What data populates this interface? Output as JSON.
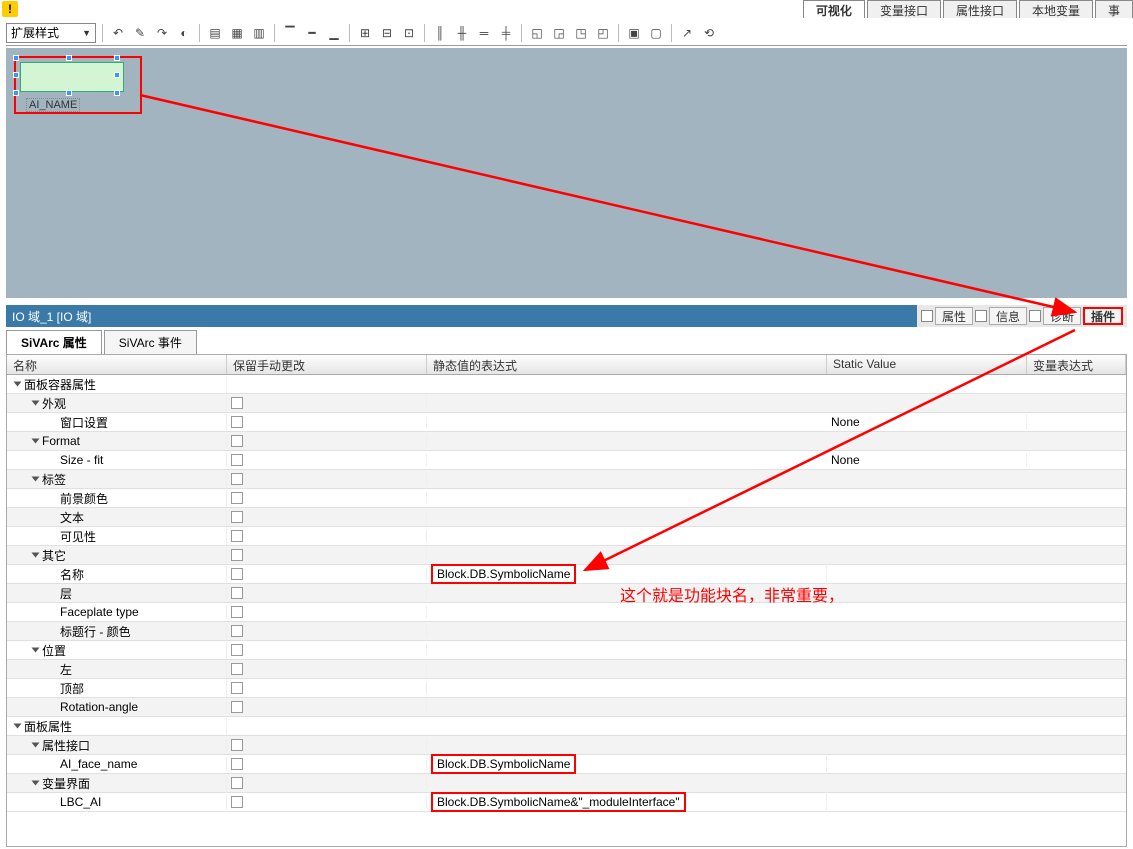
{
  "topTabs": {
    "items": [
      "可视化",
      "变量接口",
      "属性接口",
      "本地变量",
      "事"
    ],
    "activeIndex": 0
  },
  "toolbar": {
    "styleDropdown": "扩展样式"
  },
  "canvas": {
    "objectLabel": "AI_NAME"
  },
  "titleBar": {
    "title": "IO 域_1 [IO 域]",
    "buttons": {
      "properties": "属性",
      "info": "信息",
      "diagnostics": "诊断",
      "plugins": "插件"
    }
  },
  "subTabs": {
    "items": [
      "SiVArc 属性",
      "SiVArc 事件"
    ],
    "activeIndex": 0
  },
  "tableHeaders": {
    "name": "名称",
    "retain": "保留手动更改",
    "staticExpr": "静态值的表达式",
    "staticValue": "Static Value",
    "varExpr": "变量表达式"
  },
  "tableRows": [
    {
      "level": 0,
      "toggle": true,
      "open": true,
      "name": "面板容器属性",
      "chk": false,
      "expr": "",
      "static": "",
      "varExpr": ""
    },
    {
      "level": 1,
      "toggle": true,
      "open": true,
      "name": "外观",
      "chk": true,
      "expr": "",
      "static": "",
      "varExpr": ""
    },
    {
      "level": 2,
      "toggle": false,
      "name": "窗口设置",
      "chk": true,
      "expr": "",
      "static": "None",
      "varExpr": ""
    },
    {
      "level": 1,
      "toggle": true,
      "open": true,
      "name": "Format",
      "chk": true,
      "expr": "",
      "static": "",
      "varExpr": ""
    },
    {
      "level": 2,
      "toggle": false,
      "name": "Size - fit",
      "chk": true,
      "expr": "",
      "static": "None",
      "varExpr": ""
    },
    {
      "level": 1,
      "toggle": true,
      "open": true,
      "name": "标签",
      "chk": true,
      "expr": "",
      "static": "",
      "varExpr": ""
    },
    {
      "level": 2,
      "toggle": false,
      "name": "前景颜色",
      "chk": true,
      "expr": "",
      "static": "",
      "varExpr": ""
    },
    {
      "level": 2,
      "toggle": false,
      "name": "文本",
      "chk": true,
      "expr": "",
      "static": "",
      "varExpr": ""
    },
    {
      "level": 2,
      "toggle": false,
      "name": "可见性",
      "chk": true,
      "expr": "",
      "static": "",
      "varExpr": ""
    },
    {
      "level": 1,
      "toggle": true,
      "open": true,
      "name": "其它",
      "chk": true,
      "expr": "",
      "static": "",
      "varExpr": ""
    },
    {
      "level": 2,
      "toggle": false,
      "name": "名称",
      "chk": true,
      "expr": "Block.DB.SymbolicName",
      "static": "",
      "varExpr": "",
      "redbox": true
    },
    {
      "level": 2,
      "toggle": false,
      "name": "层",
      "chk": true,
      "expr": "",
      "static": "",
      "varExpr": ""
    },
    {
      "level": 2,
      "toggle": false,
      "name": "Faceplate type",
      "chk": true,
      "expr": "",
      "static": "",
      "varExpr": ""
    },
    {
      "level": 2,
      "toggle": false,
      "name": "标题行 - 颜色",
      "chk": true,
      "expr": "",
      "static": "",
      "varExpr": ""
    },
    {
      "level": 1,
      "toggle": true,
      "open": true,
      "name": "位置",
      "chk": true,
      "expr": "",
      "static": "",
      "varExpr": ""
    },
    {
      "level": 2,
      "toggle": false,
      "name": "左",
      "chk": true,
      "expr": "",
      "static": "",
      "varExpr": ""
    },
    {
      "level": 2,
      "toggle": false,
      "name": "顶部",
      "chk": true,
      "expr": "",
      "static": "",
      "varExpr": ""
    },
    {
      "level": 2,
      "toggle": false,
      "name": "Rotation-angle",
      "chk": true,
      "expr": "",
      "static": "",
      "varExpr": ""
    },
    {
      "level": 0,
      "toggle": true,
      "open": true,
      "name": "面板属性",
      "chk": false,
      "expr": "",
      "static": "",
      "varExpr": ""
    },
    {
      "level": 1,
      "toggle": true,
      "open": true,
      "name": "属性接口",
      "chk": true,
      "expr": "",
      "static": "",
      "varExpr": ""
    },
    {
      "level": 2,
      "toggle": false,
      "name": "AI_face_name",
      "chk": true,
      "expr": "Block.DB.SymbolicName",
      "static": "",
      "varExpr": "",
      "redbox": true
    },
    {
      "level": 1,
      "toggle": true,
      "open": true,
      "name": "变量界面",
      "chk": true,
      "expr": "",
      "static": "",
      "varExpr": ""
    },
    {
      "level": 2,
      "toggle": false,
      "name": "LBC_AI",
      "chk": true,
      "expr": "Block.DB.SymbolicName&\"_moduleInterface\"",
      "static": "",
      "varExpr": "",
      "redbox": true
    }
  ],
  "annotation": "这个就是功能块名，非常重要，"
}
